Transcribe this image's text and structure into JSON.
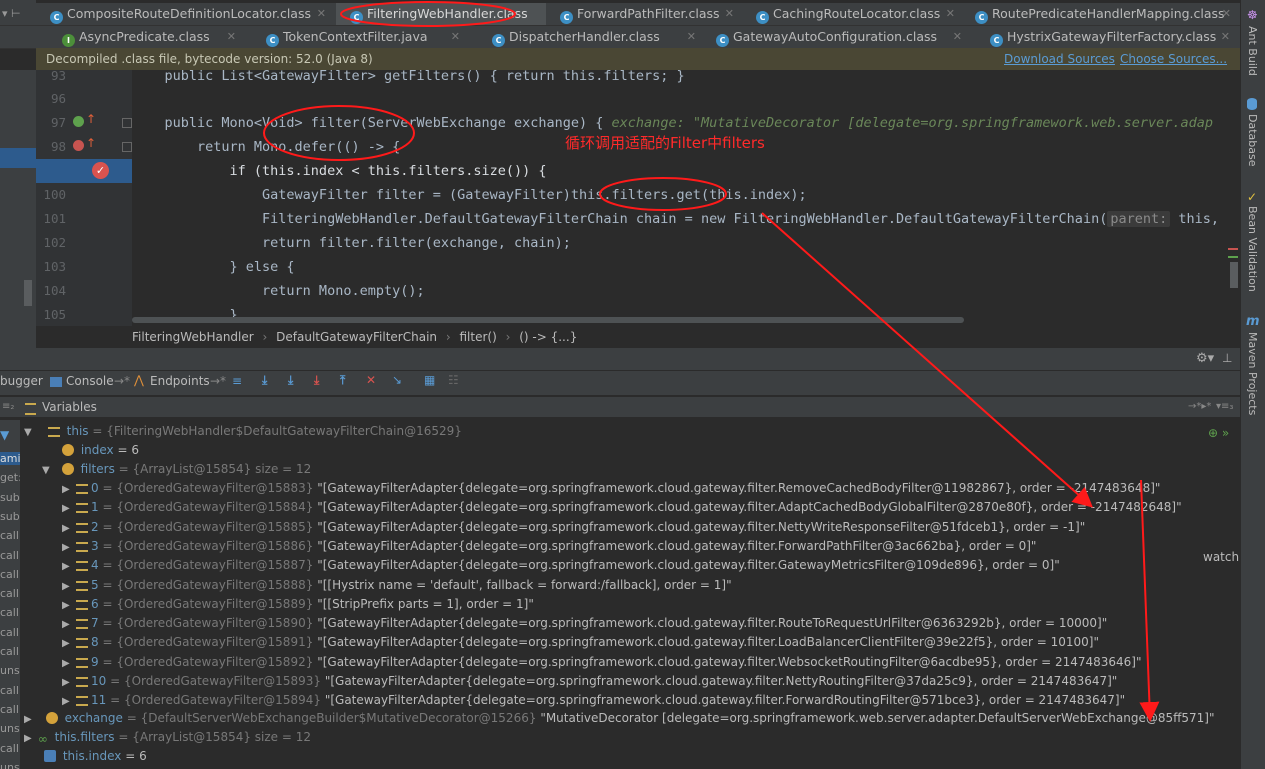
{
  "tabs_row1": [
    {
      "label": "CompositeRouteDefinitionLocator.class",
      "active": false
    },
    {
      "label": "FilteringWebHandler.class",
      "active": true
    },
    {
      "label": "ForwardPathFilter.class",
      "active": false
    },
    {
      "label": "CachingRouteLocator.class",
      "active": false
    },
    {
      "label": "RoutePredicateHandlerMapping.class",
      "active": false
    }
  ],
  "tabs_row2": [
    {
      "label": "AsyncPredicate.class"
    },
    {
      "label": "TokenContextFilter.java"
    },
    {
      "label": "DispatcherHandler.class"
    },
    {
      "label": "GatewayAutoConfiguration.class"
    },
    {
      "label": "HystrixGatewayFilterFactory.class"
    }
  ],
  "banner": {
    "text": "Decompiled .class file, bytecode version: 52.0 (Java 8)",
    "download": "Download Sources",
    "choose": "Choose Sources..."
  },
  "code": {
    "line_numbers": [
      "93",
      "96",
      "97",
      "98",
      "99",
      "100",
      "101",
      "102",
      "103",
      "104",
      "105"
    ],
    "l93": "    public List<GatewayFilter> getFilters() { return this.filters; }",
    "l97a": "    public Mono<Void> filter(ServerWebExchange exchange) {",
    "l97hint": "exchange: \"MutativeDecorator [delegate=org.springframework.web.server.adap",
    "l98": "        return Mono.defer(() -> {",
    "annotation": "循环调用适配的Filter中filters",
    "l99": "            if (this.index < this.filters.size()) {",
    "l100": "                GatewayFilter filter = (GatewayFilter)this.filters.get(this.index);",
    "l101a": "                FilteringWebHandler.DefaultGatewayFilterChain chain = new FilteringWebHandler.DefaultGatewayFilterChain(",
    "l101param": "parent:",
    "l101b": " this,",
    "l102": "                return filter.filter(exchange, chain);",
    "l103": "            } else {",
    "l104": "                return Mono.empty();",
    "l105": "            }"
  },
  "breadcrumb": [
    "FilteringWebHandler",
    "DefaultGatewayFilterChain",
    "filter()",
    "() -> {...}"
  ],
  "debug_tabs": {
    "debugger": "bugger",
    "console": "Console",
    "endpoints": "Endpoints"
  },
  "variables_title": "Variables",
  "left_stack": [
    "ami",
    "get:",
    "subs",
    "subs",
    "call:",
    "call:",
    "call:",
    "call:",
    "call:",
    "call:",
    "call:",
    "unsa",
    "call:",
    "call:",
    "unsa",
    "call:",
    "unsa"
  ],
  "watch_label": "watch",
  "vars": {
    "this": {
      "name": "this",
      "value": "= {FilteringWebHandler$DefaultGatewayFilterChain@16529}"
    },
    "index": {
      "name": "index",
      "value": "= 6"
    },
    "filters": {
      "name": "filters",
      "value": "= {ArrayList@15854}  size = 12"
    },
    "items": [
      {
        "idx": "0",
        "ref": "= {OrderedGatewayFilter@15883}",
        "val": "\"[GatewayFilterAdapter{delegate=org.springframework.cloud.gateway.filter.RemoveCachedBodyFilter@11982867}, order = -2147483648]\""
      },
      {
        "idx": "1",
        "ref": "= {OrderedGatewayFilter@15884}",
        "val": "\"[GatewayFilterAdapter{delegate=org.springframework.cloud.gateway.filter.AdaptCachedBodyGlobalFilter@2870e80f}, order = -2147482648]\""
      },
      {
        "idx": "2",
        "ref": "= {OrderedGatewayFilter@15885}",
        "val": "\"[GatewayFilterAdapter{delegate=org.springframework.cloud.gateway.filter.NettyWriteResponseFilter@51fdceb1}, order = -1]\""
      },
      {
        "idx": "3",
        "ref": "= {OrderedGatewayFilter@15886}",
        "val": "\"[GatewayFilterAdapter{delegate=org.springframework.cloud.gateway.filter.ForwardPathFilter@3ac662ba}, order = 0]\""
      },
      {
        "idx": "4",
        "ref": "= {OrderedGatewayFilter@15887}",
        "val": "\"[GatewayFilterAdapter{delegate=org.springframework.cloud.gateway.filter.GatewayMetricsFilter@109de896}, order = 0]\""
      },
      {
        "idx": "5",
        "ref": "= {OrderedGatewayFilter@15888}",
        "val": "\"[[Hystrix name = 'default', fallback = forward:/fallback], order = 1]\""
      },
      {
        "idx": "6",
        "ref": "= {OrderedGatewayFilter@15889}",
        "val": "\"[[StripPrefix parts = 1], order = 1]\""
      },
      {
        "idx": "7",
        "ref": "= {OrderedGatewayFilter@15890}",
        "val": "\"[GatewayFilterAdapter{delegate=org.springframework.cloud.gateway.filter.RouteToRequestUrlFilter@6363292b}, order = 10000]\""
      },
      {
        "idx": "8",
        "ref": "= {OrderedGatewayFilter@15891}",
        "val": "\"[GatewayFilterAdapter{delegate=org.springframework.cloud.gateway.filter.LoadBalancerClientFilter@39e22f5}, order = 10100]\""
      },
      {
        "idx": "9",
        "ref": "= {OrderedGatewayFilter@15892}",
        "val": "\"[GatewayFilterAdapter{delegate=org.springframework.cloud.gateway.filter.WebsocketRoutingFilter@6acdbe95}, order = 2147483646]\""
      },
      {
        "idx": "10",
        "ref": "= {OrderedGatewayFilter@15893}",
        "val": "\"[GatewayFilterAdapter{delegate=org.springframework.cloud.gateway.filter.NettyRoutingFilter@37da25c9}, order = 2147483647]\""
      },
      {
        "idx": "11",
        "ref": "= {OrderedGatewayFilter@15894}",
        "val": "\"[GatewayFilterAdapter{delegate=org.springframework.cloud.gateway.filter.ForwardRoutingFilter@571bce3}, order = 2147483647]\""
      }
    ],
    "exchange": {
      "name": "exchange",
      "ref": "= {DefaultServerWebExchangeBuilder$MutativeDecorator@15266}",
      "val": "\"MutativeDecorator [delegate=org.springframework.web.server.adapter.DefaultServerWebExchange@85ff571]\""
    },
    "this_filters": {
      "name": "this.filters",
      "value": "= {ArrayList@15854}  size = 12"
    },
    "this_index": {
      "name": "this.index",
      "value": "= 6"
    }
  },
  "right_sidebar": [
    "Ant Build",
    "Database",
    "Bean Validation",
    "Maven Projects"
  ],
  "colors": {
    "annotation": "#ff2020",
    "highlight": "#2d5b8d",
    "banner": "#4a4734"
  }
}
